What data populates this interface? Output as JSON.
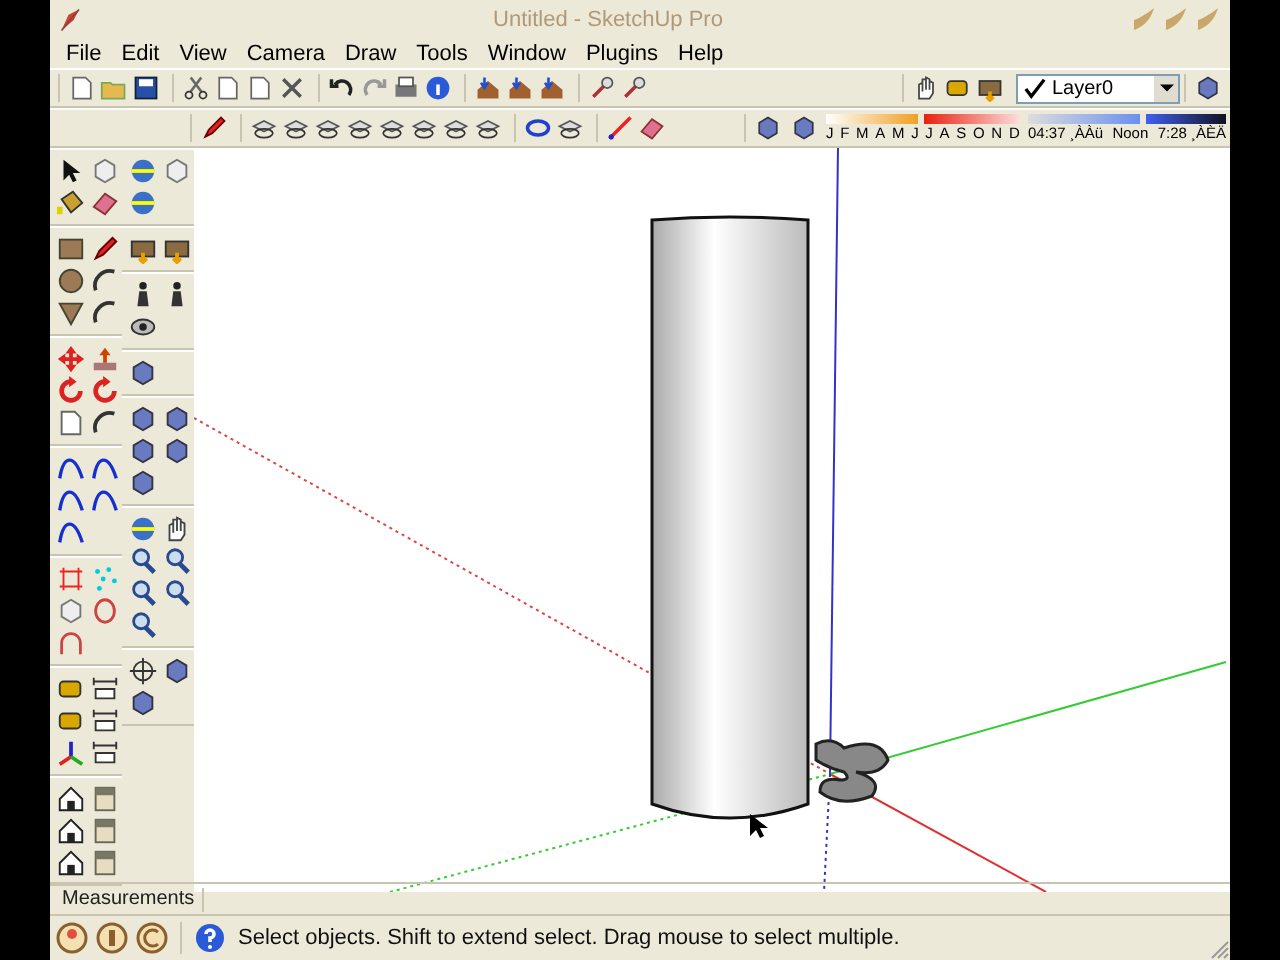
{
  "window": {
    "title": "Untitled - SketchUp Pro"
  },
  "menu": [
    "File",
    "Edit",
    "View",
    "Camera",
    "Draw",
    "Tools",
    "Window",
    "Plugins",
    "Help"
  ],
  "layer_dropdown": {
    "value": "Layer0"
  },
  "shadow_settings": {
    "months": [
      "J",
      "F",
      "M",
      "A",
      "M",
      "J",
      "J",
      "A",
      "S",
      "O",
      "N",
      "D"
    ],
    "time_start": "04:37 ¸ÀÀü",
    "time_noon": "Noon",
    "time_end": "7:28 ¸ÀÈÄ"
  },
  "measurements": {
    "label": "Measurements"
  },
  "status_bar": {
    "message": "Select objects. Shift to extend select. Drag mouse to select multiple."
  }
}
